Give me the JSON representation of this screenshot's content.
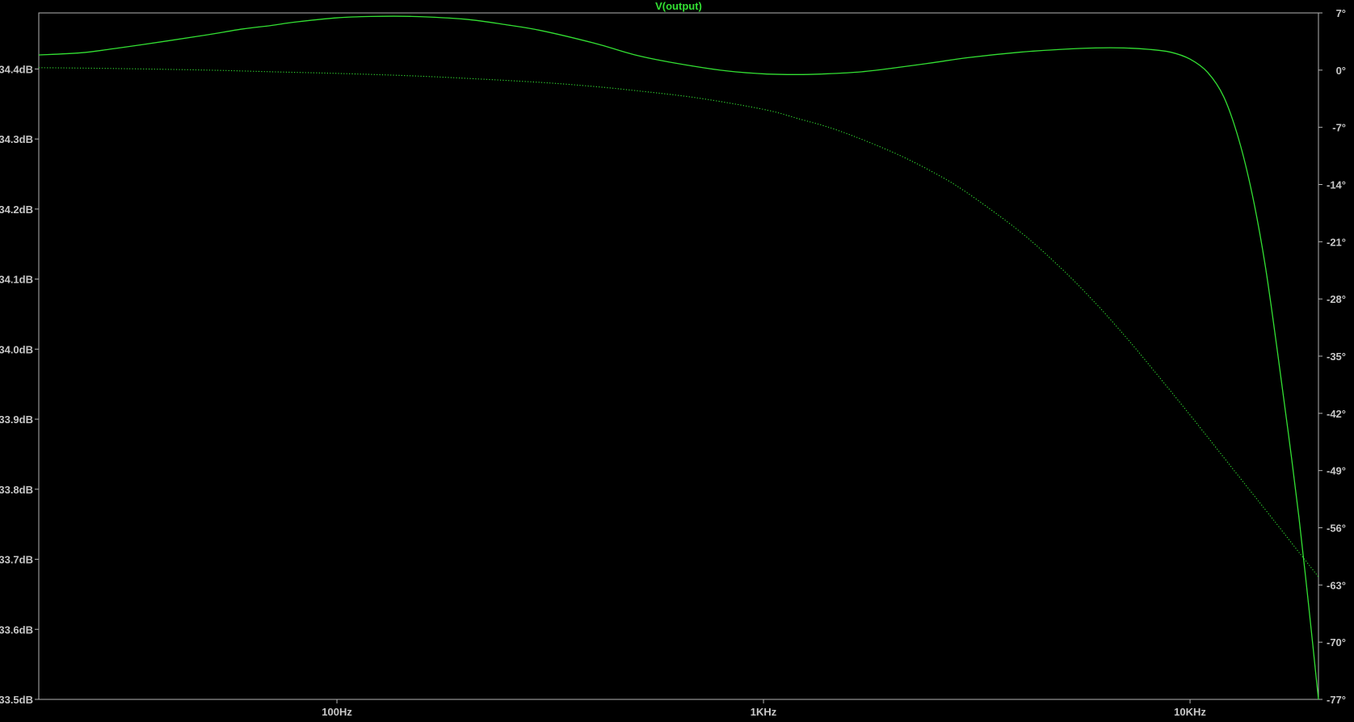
{
  "chart_data": {
    "type": "line",
    "title": "V(output)",
    "x_scale": "log",
    "xlim": [
      20,
      20000
    ],
    "x_ticks": [
      {
        "value": 100,
        "label": "100Hz"
      },
      {
        "value": 1000,
        "label": "1KHz"
      },
      {
        "value": 10000,
        "label": "10KHz"
      }
    ],
    "y_left": {
      "unit": "dB",
      "ylim": [
        33.5,
        34.48
      ],
      "ticks": [
        {
          "value": 34.4,
          "label": "34.4dB"
        },
        {
          "value": 34.3,
          "label": "34.3dB"
        },
        {
          "value": 34.2,
          "label": "34.2dB"
        },
        {
          "value": 34.1,
          "label": "34.1dB"
        },
        {
          "value": 34.0,
          "label": "34.0dB"
        },
        {
          "value": 33.9,
          "label": "33.9dB"
        },
        {
          "value": 33.8,
          "label": "33.8dB"
        },
        {
          "value": 33.7,
          "label": "33.7dB"
        },
        {
          "value": 33.6,
          "label": "33.6dB"
        },
        {
          "value": 33.5,
          "label": "33.5dB"
        }
      ]
    },
    "y_right": {
      "unit": "°",
      "ylim": [
        -77,
        7
      ],
      "ticks": [
        {
          "value": 7,
          "label": "7°"
        },
        {
          "value": 0,
          "label": "0°"
        },
        {
          "value": -7,
          "label": "-7°"
        },
        {
          "value": -14,
          "label": "-14°"
        },
        {
          "value": -21,
          "label": "-21°"
        },
        {
          "value": -28,
          "label": "-28°"
        },
        {
          "value": -35,
          "label": "-35°"
        },
        {
          "value": -42,
          "label": "-42°"
        },
        {
          "value": -49,
          "label": "-49°"
        },
        {
          "value": -56,
          "label": "-56°"
        },
        {
          "value": -63,
          "label": "-63°"
        },
        {
          "value": -70,
          "label": "-70°"
        },
        {
          "value": -77,
          "label": "-77°"
        }
      ]
    },
    "series": [
      {
        "name": "V(output)",
        "quantity": "magnitude",
        "axis": "left",
        "style": "solid",
        "color": "#33e033",
        "x": [
          20,
          25,
          30,
          40,
          50,
          60,
          70,
          80,
          100,
          120,
          150,
          200,
          250,
          300,
          400,
          500,
          600,
          800,
          1000,
          1200,
          1400,
          1700,
          2000,
          2500,
          3000,
          4000,
          5000,
          6000,
          7000,
          8000,
          9000,
          10000,
          11000,
          12000,
          13000,
          14000,
          15000,
          16000,
          17000,
          18000,
          19000,
          20000
        ],
        "values": [
          34.42,
          34.423,
          34.429,
          34.44,
          34.449,
          34.457,
          34.462,
          34.467,
          34.473,
          34.475,
          34.475,
          34.471,
          34.463,
          34.455,
          34.437,
          34.42,
          34.41,
          34.398,
          34.393,
          34.392,
          34.393,
          34.396,
          34.401,
          34.409,
          34.416,
          34.424,
          34.428,
          34.43,
          34.43,
          34.428,
          34.424,
          34.414,
          34.395,
          34.36,
          34.3,
          34.22,
          34.12,
          34.0,
          33.88,
          33.76,
          33.63,
          33.5
        ]
      },
      {
        "name": "V(output) phase",
        "quantity": "phase",
        "axis": "right",
        "style": "dotted",
        "color": "#33e033",
        "x": [
          20,
          30,
          50,
          70,
          100,
          150,
          200,
          300,
          400,
          500,
          700,
          1000,
          1200,
          1500,
          2000,
          2500,
          3000,
          4000,
          5000,
          6000,
          7000,
          8000,
          10000,
          12000,
          14000,
          16000,
          18000,
          20000
        ],
        "values": [
          0.3,
          0.2,
          0.0,
          -0.2,
          -0.4,
          -0.7,
          -1.0,
          -1.5,
          -2.0,
          -2.5,
          -3.4,
          -4.8,
          -5.9,
          -7.4,
          -10.0,
          -12.5,
          -15.0,
          -19.8,
          -24.3,
          -28.5,
          -32.4,
          -36.0,
          -42.2,
          -47.4,
          -51.8,
          -55.6,
          -59.0,
          -62.0
        ]
      }
    ]
  }
}
